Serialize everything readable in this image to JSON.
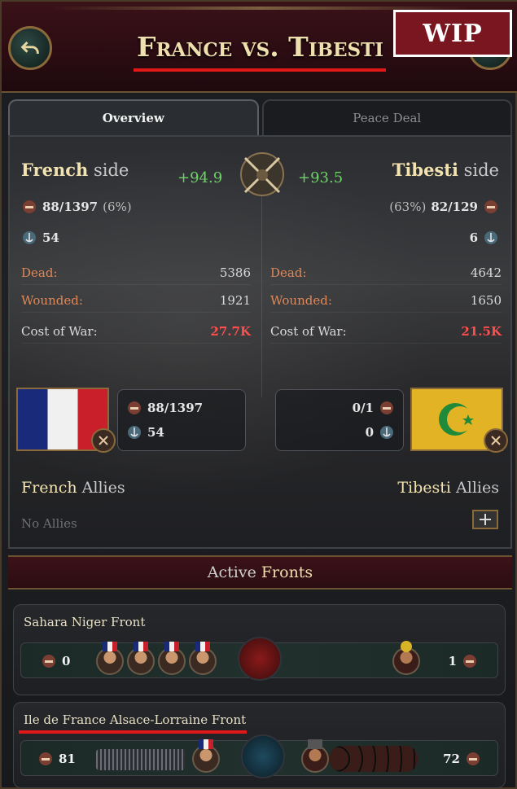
{
  "header": {
    "title": "France vs. Tibesti",
    "wip_label": "WIP"
  },
  "tabs": [
    {
      "label": "Overview",
      "active": true
    },
    {
      "label": "Peace Deal",
      "active": false
    }
  ],
  "overview": {
    "left": {
      "name": "French",
      "side_word": "side",
      "score": "+94.9",
      "army": "88/1397",
      "army_pct": "(6%)",
      "navy": "54",
      "dead_label": "Dead:",
      "dead": "5386",
      "wounded_label": "Wounded:",
      "wounded": "1921",
      "cost_label": "Cost of War:",
      "cost": "27.7K",
      "card_army": "88/1397",
      "card_navy": "54",
      "allies_name": "French",
      "allies_word": "Allies",
      "allies_empty": "No Allies"
    },
    "right": {
      "name": "Tibesti",
      "side_word": "side",
      "score": "+93.5",
      "army": "82/129",
      "army_pct": "(63%)",
      "navy": "6",
      "dead_label": "Dead:",
      "dead": "4642",
      "wounded_label": "Wounded:",
      "wounded": "1650",
      "cost_label": "Cost of War:",
      "cost": "21.5K",
      "card_army": "0/1",
      "card_navy": "0",
      "allies_name": "Tibesti",
      "allies_word": "Allies"
    }
  },
  "fronts": {
    "header_word_1": "Active",
    "header_word_2": "Fronts",
    "items": [
      {
        "name": "Sahara Niger Front",
        "left_count": "0",
        "right_count": "1"
      },
      {
        "name": "Ile de France Alsace-Lorraine Front",
        "left_count": "81",
        "right_count": "72"
      }
    ]
  },
  "colors": {
    "accent_gold": "#f3e3b1",
    "score_green": "#6fd36a",
    "cost_red": "#ff4e4e",
    "label_orange": "#e08858",
    "annotation_red": "#e01818"
  }
}
